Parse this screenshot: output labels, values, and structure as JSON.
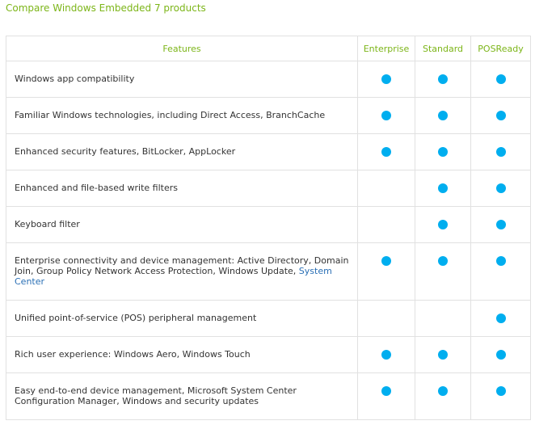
{
  "title": "Compare Windows Embedded 7 products",
  "header": {
    "features": "Features",
    "enterprise": "Enterprise",
    "standard": "Standard",
    "posready": "POSReady"
  },
  "rows": [
    {
      "feature": "Windows app compatibility",
      "enterprise": true,
      "standard": true,
      "posready": true
    },
    {
      "feature": "Familiar Windows technologies, including Direct Access, BranchCache",
      "enterprise": true,
      "standard": true,
      "posready": true
    },
    {
      "feature": "Enhanced security features, BitLocker, AppLocker",
      "enterprise": true,
      "standard": true,
      "posready": true
    },
    {
      "feature": "Enhanced and file-based write filters",
      "enterprise": false,
      "standard": true,
      "posready": true
    },
    {
      "feature": "Keyboard filter",
      "enterprise": false,
      "standard": true,
      "posready": true
    },
    {
      "feature": "Enterprise connectivity and device management: Active Directory, Domain Join, Group Policy Network Access Protection, Windows Update, ",
      "link": "System Center",
      "enterprise": true,
      "standard": true,
      "posready": true
    },
    {
      "feature": "Unified point-of-service (POS) peripheral management",
      "enterprise": false,
      "standard": false,
      "posready": true
    },
    {
      "feature": "Rich user experience: Windows Aero, Windows Touch",
      "enterprise": true,
      "standard": true,
      "posready": true
    },
    {
      "feature": "Easy end-to-end device management, Microsoft System Center Configuration Manager, Windows and security updates",
      "enterprise": true,
      "standard": true,
      "posready": true
    }
  ],
  "colors": {
    "accent": "#7cb518",
    "dot": "#00aeef",
    "link": "#2a6fb5",
    "border": "#e1e1e1"
  }
}
